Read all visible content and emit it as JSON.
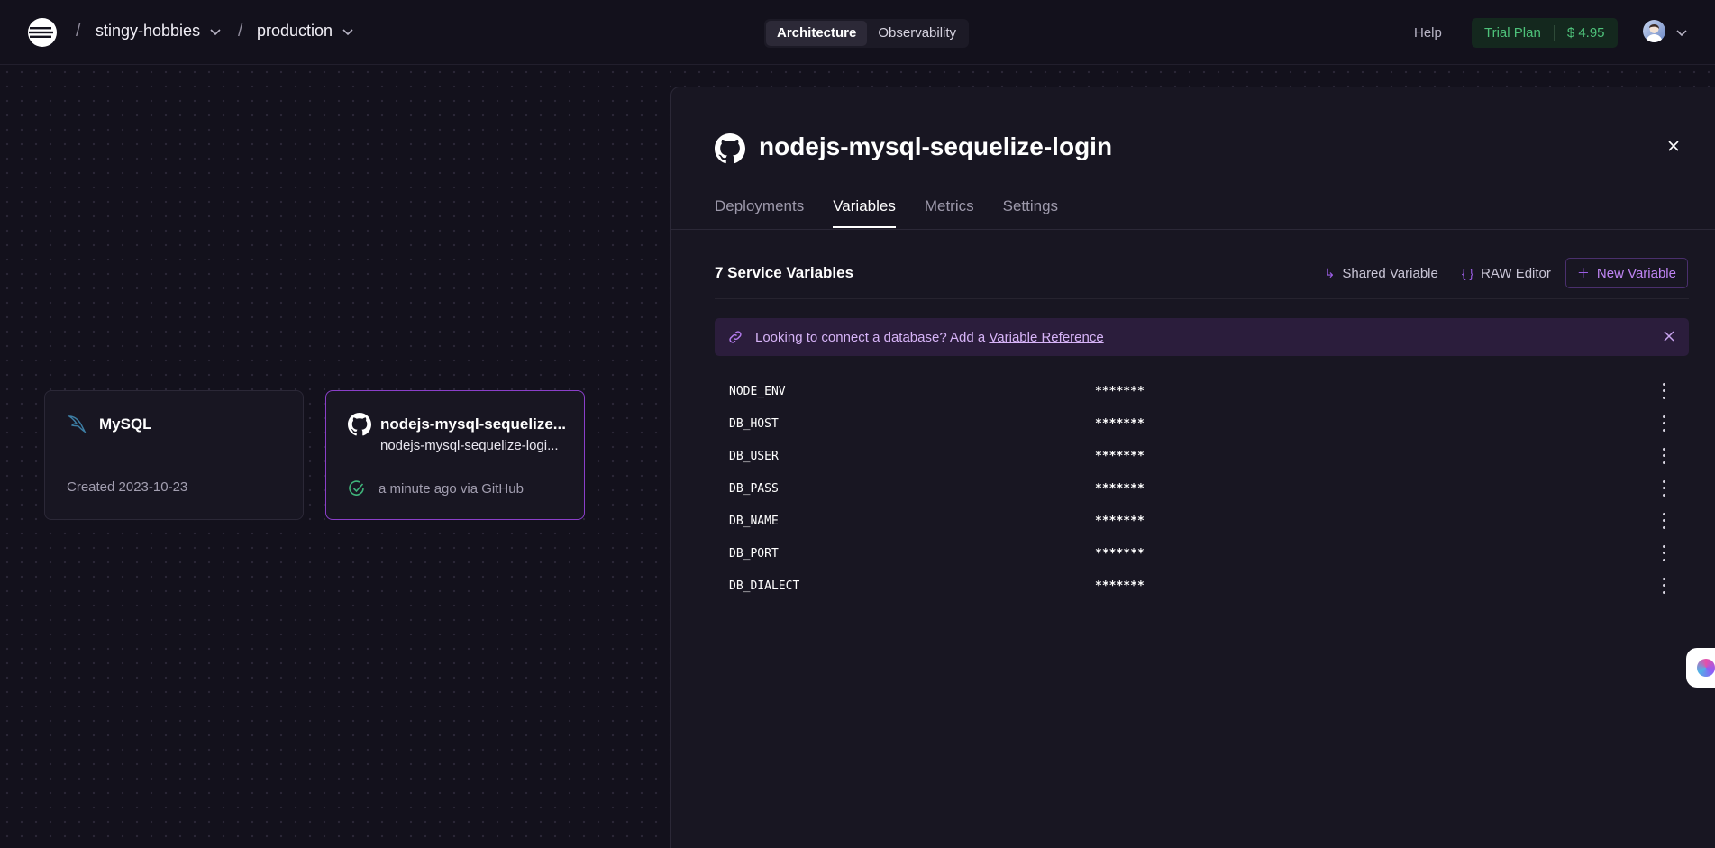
{
  "header": {
    "project": "stingy-hobbies",
    "environment": "production",
    "view_tabs": [
      {
        "label": "Architecture",
        "active": true
      },
      {
        "label": "Observability",
        "active": false
      }
    ],
    "help_label": "Help",
    "plan_label": "Trial Plan",
    "plan_balance": "$ 4.95"
  },
  "cards": [
    {
      "title": "MySQL",
      "subtitle": "",
      "footer": "Created 2023-10-23",
      "icon": "dolphin-icon",
      "selected": false
    },
    {
      "title": "nodejs-mysql-sequelize...",
      "subtitle": "nodejs-mysql-sequelize-logi...",
      "footer": "a minute ago via GitHub",
      "icon": "github-icon",
      "selected": true
    }
  ],
  "panel": {
    "title": "nodejs-mysql-sequelize-login",
    "tabs": [
      {
        "label": "Deployments",
        "active": false
      },
      {
        "label": "Variables",
        "active": true
      },
      {
        "label": "Metrics",
        "active": false
      },
      {
        "label": "Settings",
        "active": false
      }
    ],
    "vars_heading": "7 Service Variables",
    "actions": {
      "shared": "Shared Variable",
      "raw": "RAW Editor",
      "new": "New Variable"
    },
    "banner": {
      "text": "Looking to connect a database? Add a",
      "link": "Variable Reference"
    },
    "variables": [
      {
        "name": "NODE_ENV",
        "value": "*******"
      },
      {
        "name": "DB_HOST",
        "value": "*******"
      },
      {
        "name": "DB_USER",
        "value": "*******"
      },
      {
        "name": "DB_PASS",
        "value": "*******"
      },
      {
        "name": "DB_NAME",
        "value": "*******"
      },
      {
        "name": "DB_PORT",
        "value": "*******"
      },
      {
        "name": "DB_DIALECT",
        "value": "*******"
      }
    ]
  },
  "colors": {
    "background": "#13111c",
    "accent": "#9b5de5",
    "success": "#4ec27a"
  }
}
